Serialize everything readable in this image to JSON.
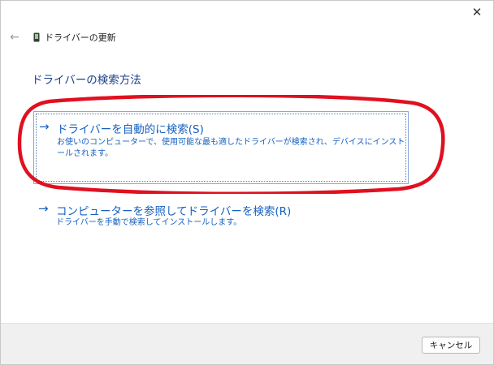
{
  "window": {
    "title": "ドライバーの更新",
    "close_glyph": "✕",
    "back_glyph": "←"
  },
  "page": {
    "title": "ドライバーの検索方法"
  },
  "options": [
    {
      "arrow": "→",
      "label": "ドライバーを自動的に検索(S)",
      "description": "お使いのコンピューターで、使用可能な最も適したドライバーが検索され、デバイスにインストールされます。"
    },
    {
      "arrow": "→",
      "label": "コンピューターを参照してドライバーを検索(R)",
      "description": "ドライバーを手動で検索してインストールします。"
    }
  ],
  "footer": {
    "cancel_label": "キャンセル"
  },
  "colors": {
    "link": "#1560c0",
    "title": "#1a3e8c",
    "annotation": "#e01020"
  },
  "icons": {
    "back": "back-arrow-icon",
    "device": "device-icon",
    "close": "close-icon",
    "option_arrow": "arrow-right-icon"
  }
}
